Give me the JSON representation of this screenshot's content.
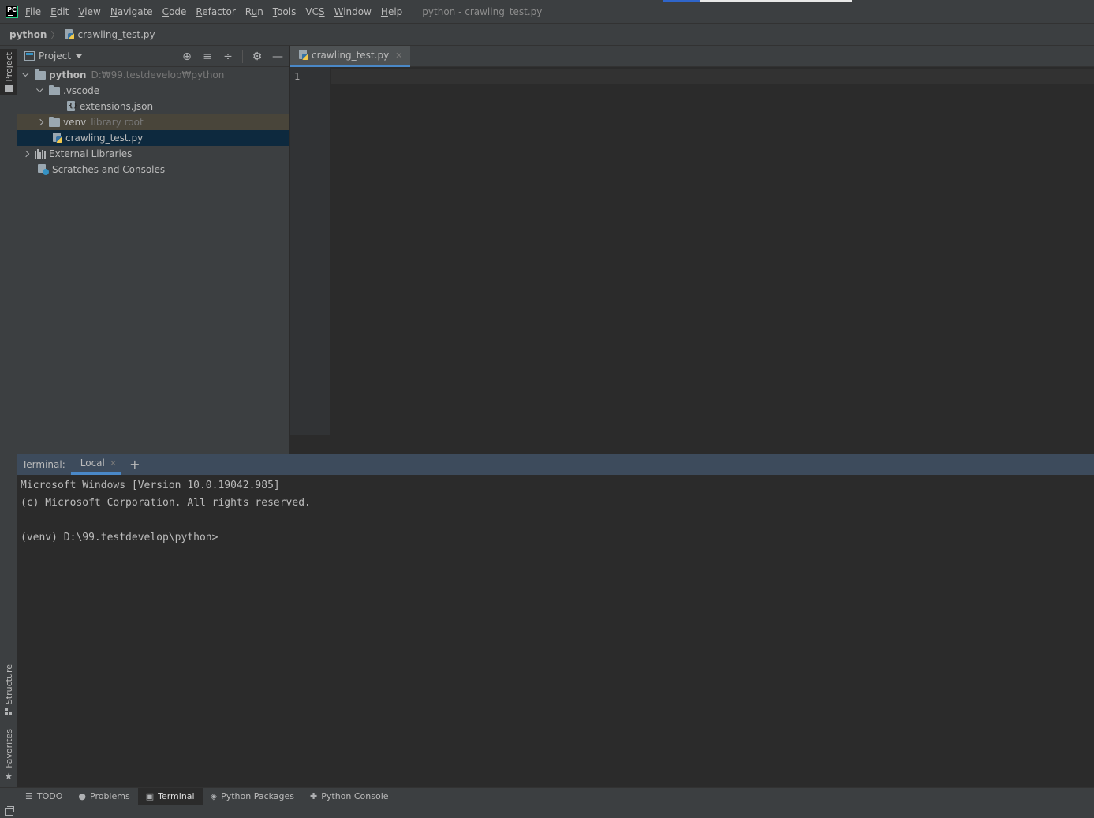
{
  "menu": {
    "app_logo": "PC",
    "items": [
      {
        "mnemonic": "F",
        "rest": "ile"
      },
      {
        "mnemonic": "E",
        "rest": "dit"
      },
      {
        "mnemonic": "V",
        "rest": "iew"
      },
      {
        "mnemonic": "N",
        "rest": "avigate"
      },
      {
        "mnemonic": "C",
        "rest": "ode"
      },
      {
        "mnemonic": "R",
        "rest": "efactor"
      },
      {
        "pre": "R",
        "mnemonic": "u",
        "rest": "n"
      },
      {
        "mnemonic": "T",
        "rest": "ools"
      },
      {
        "pre": "VC",
        "mnemonic": "S",
        "rest": ""
      },
      {
        "mnemonic": "W",
        "rest": "indow"
      },
      {
        "mnemonic": "H",
        "rest": "elp"
      }
    ],
    "window_title": "python - crawling_test.py"
  },
  "navbar": {
    "root": "python",
    "file": "crawling_test.py"
  },
  "left_stripe": {
    "project": "Project",
    "structure": "Structure",
    "favorites": "Favorites"
  },
  "project": {
    "title": "Project",
    "tree": [
      {
        "label": "python",
        "hint": "D:₩99.testdevelop₩python"
      },
      {
        "label": ".vscode"
      },
      {
        "label": "extensions.json"
      },
      {
        "label": "venv",
        "hint": "library root"
      },
      {
        "label": "crawling_test.py"
      },
      {
        "label": "External Libraries"
      },
      {
        "label": "Scratches and Consoles"
      }
    ]
  },
  "editor": {
    "tab_label": "crawling_test.py",
    "line_numbers": [
      "1"
    ]
  },
  "terminal": {
    "title": "Terminal:",
    "tab_label": "Local",
    "lines": [
      "Microsoft Windows [Version 10.0.19042.985]",
      "(c) Microsoft Corporation. All rights reserved.",
      "",
      "(venv) D:\\99.testdevelop\\python>"
    ]
  },
  "bottom_tools": [
    {
      "label": "TODO",
      "icon": "list-icon"
    },
    {
      "label": "Problems",
      "icon": "info-icon"
    },
    {
      "label": "Terminal",
      "icon": "terminal-icon"
    },
    {
      "label": "Python Packages",
      "icon": "layers-icon"
    },
    {
      "label": "Python Console",
      "icon": "python-console-icon"
    }
  ],
  "colors": {
    "accent": "#4a88c7",
    "selection": "#0d293e",
    "library_highlight": "#49453a"
  }
}
